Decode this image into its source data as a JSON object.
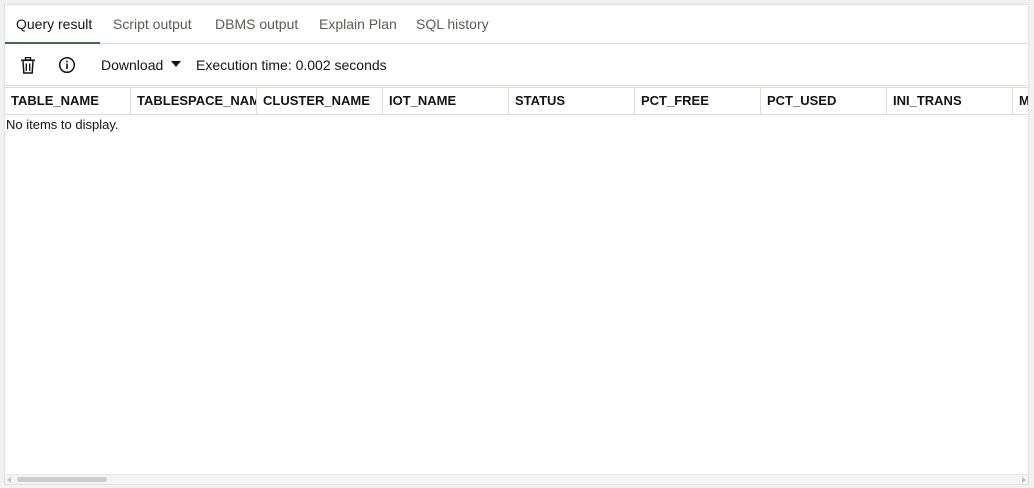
{
  "tabs": [
    {
      "label": "Query result",
      "active": true
    },
    {
      "label": "Script output",
      "active": false
    },
    {
      "label": "DBMS output",
      "active": false
    },
    {
      "label": "Explain Plan",
      "active": false
    },
    {
      "label": "SQL history",
      "active": false
    }
  ],
  "toolbar": {
    "delete_icon": "trash-icon",
    "info_icon": "info-icon",
    "download_label": "Download",
    "download_caret_icon": "caret-down-icon",
    "execution_time": "Execution time: 0.002 seconds"
  },
  "grid": {
    "columns": [
      "TABLE_NAME",
      "TABLESPACE_NAME",
      "CLUSTER_NAME",
      "IOT_NAME",
      "STATUS",
      "PCT_FREE",
      "PCT_USED",
      "INI_TRANS",
      "MAX_TRANS"
    ],
    "empty_message": "No items to display."
  },
  "colors": {
    "active_tab_underline": "#3c6e4c",
    "border": "#dedbd7",
    "text": "#161513",
    "muted_text": "#5e5b57"
  }
}
